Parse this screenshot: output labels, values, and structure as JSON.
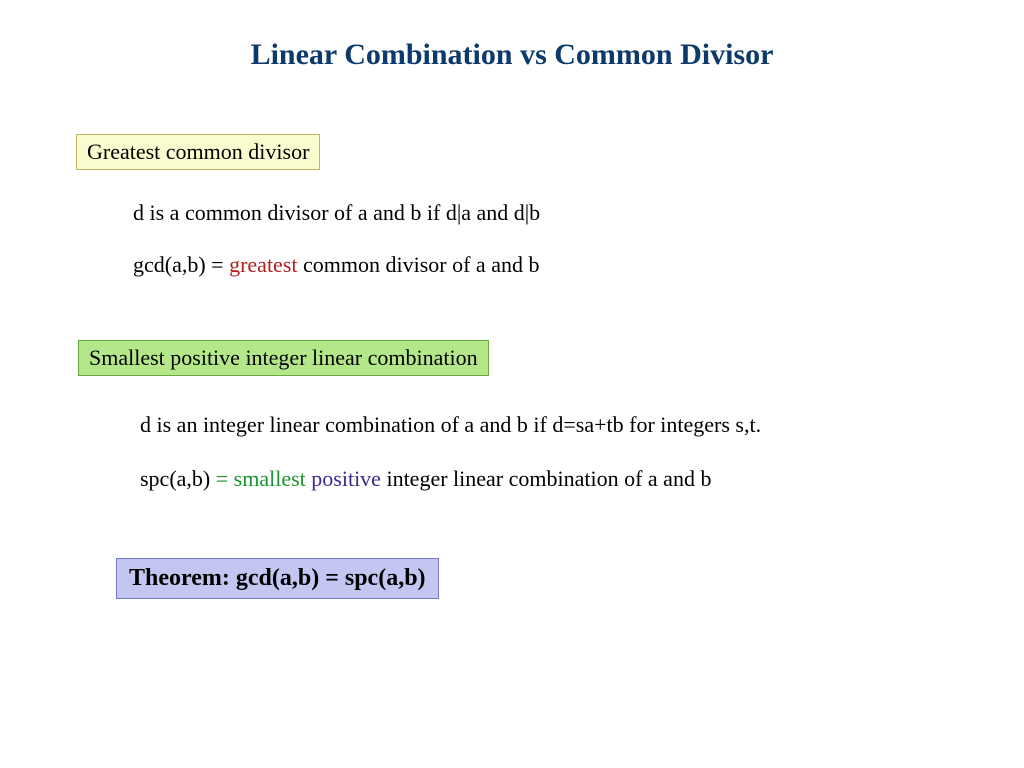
{
  "title": "Linear Combination vs Common Divisor",
  "box_gcd": "Greatest common divisor",
  "line_d_common": "d is a common divisor of a and b if d|a and d|b",
  "line_gcd_pre": "gcd(a,b) = ",
  "line_gcd_red": "greatest",
  "line_gcd_post": " common divisor of a and b",
  "box_spc": "Smallest positive integer linear combination",
  "line_d_integer": "d is an integer linear combination of a and b if d=sa+tb for integers s,t.",
  "line_spc_pre": "spc(a,b) ",
  "line_spc_eq": "= ",
  "line_spc_green": "smallest ",
  "line_spc_purple": "positive",
  "line_spc_post": " integer linear combination of a and b",
  "box_theorem": "Theorem:  gcd(a,b) = spc(a,b)"
}
